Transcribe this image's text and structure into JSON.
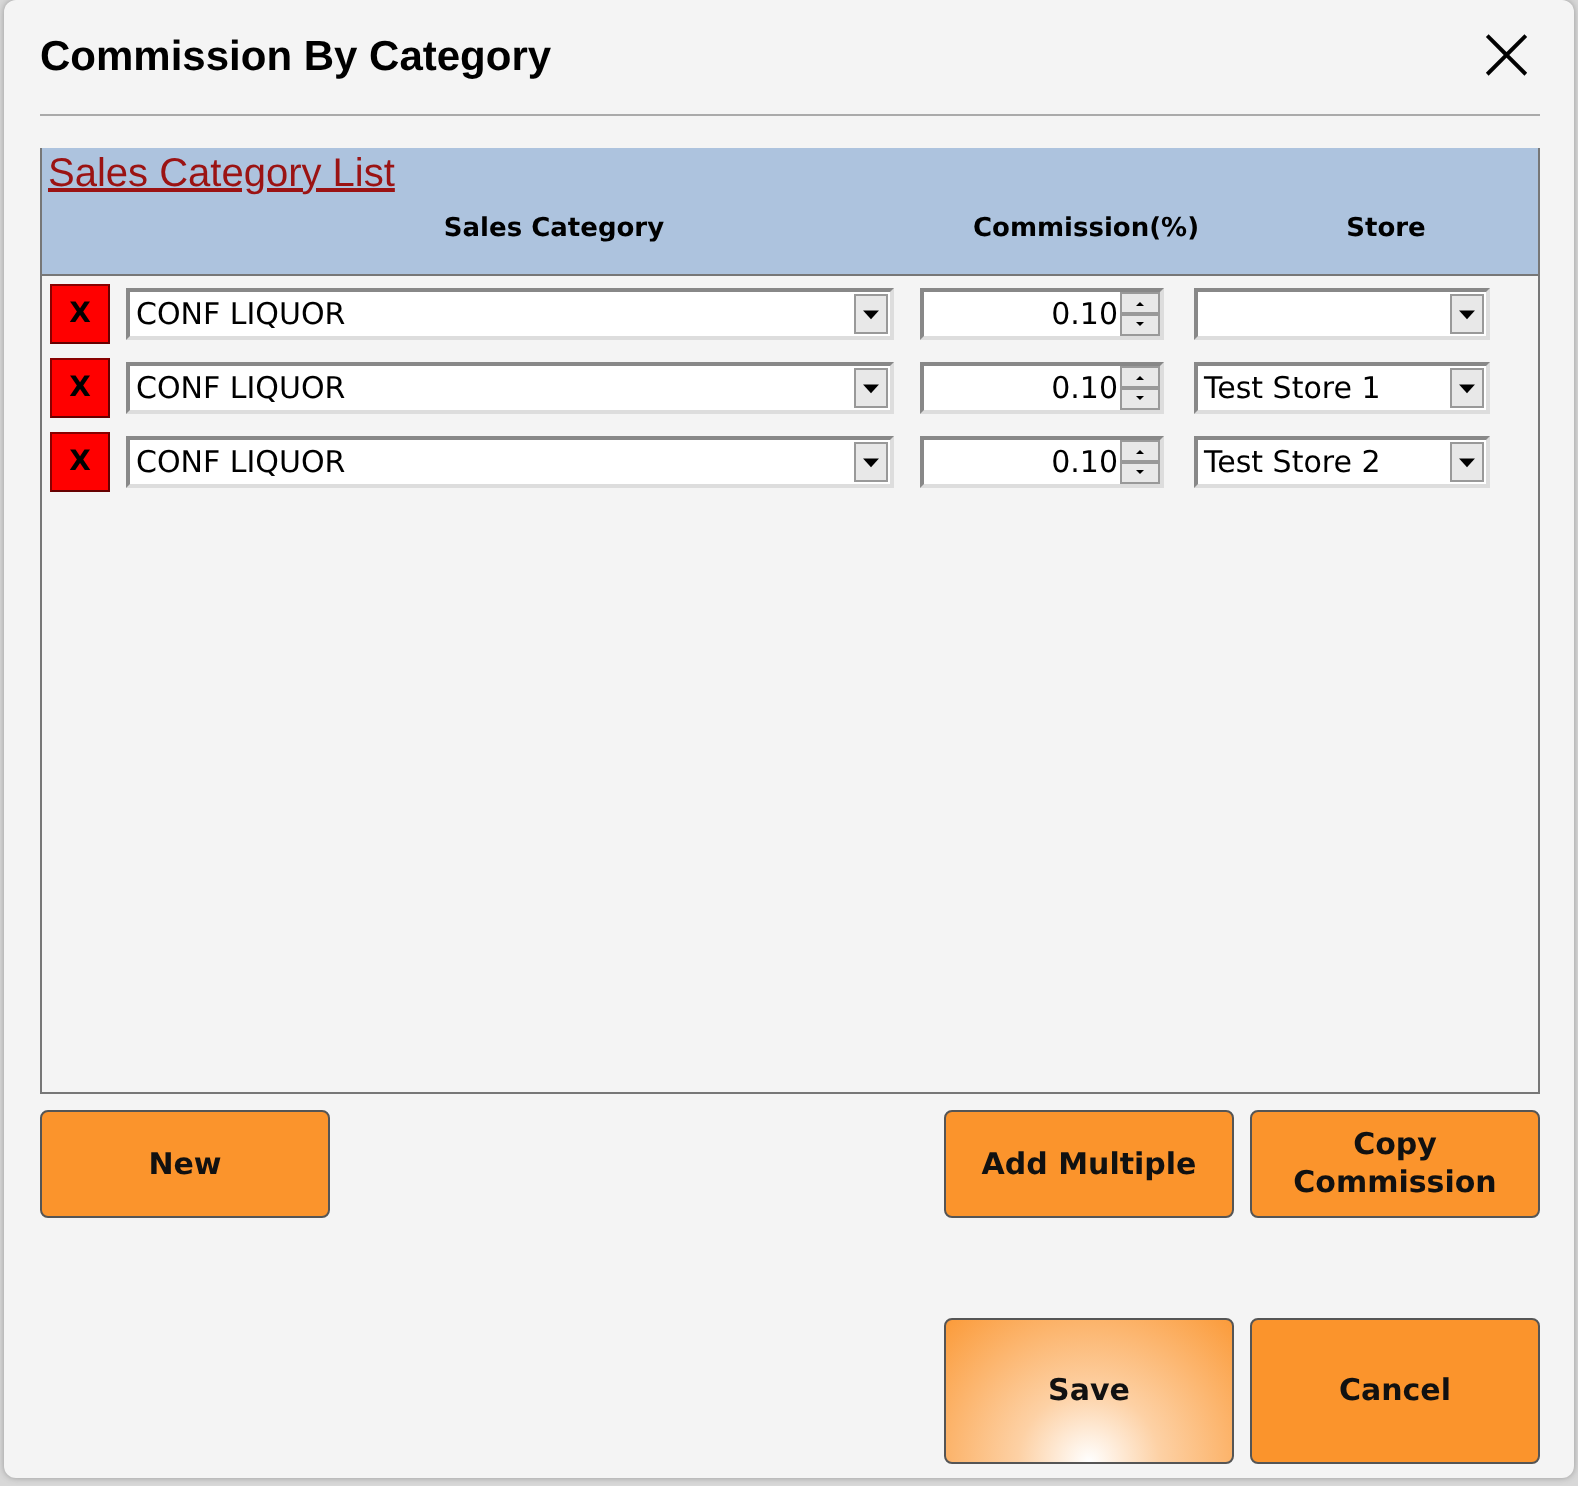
{
  "window": {
    "title": "Commission By Category",
    "close": "×"
  },
  "panel": {
    "title": "Sales Category List",
    "columns": [
      "Sales Category",
      "Commission(%)",
      "Store"
    ],
    "rows": [
      {
        "remove": "X",
        "category": "CONF LIQUOR",
        "commission": "0.10",
        "store": ""
      },
      {
        "remove": "X",
        "category": "CONF LIQUOR",
        "commission": "0.10",
        "store": "Test Store 1"
      },
      {
        "remove": "X",
        "category": "CONF LIQUOR",
        "commission": "0.10",
        "store": "Test Store 2"
      }
    ]
  },
  "actions": [
    {
      "label": "New",
      "highlighted": false
    },
    {
      "label": "Add Multiple",
      "highlighted": false
    },
    {
      "label": "Copy Commission",
      "highlighted": false
    }
  ],
  "footer": [
    {
      "label": "Save",
      "highlighted": true
    },
    {
      "label": "Cancel",
      "highlighted": false
    }
  ]
}
